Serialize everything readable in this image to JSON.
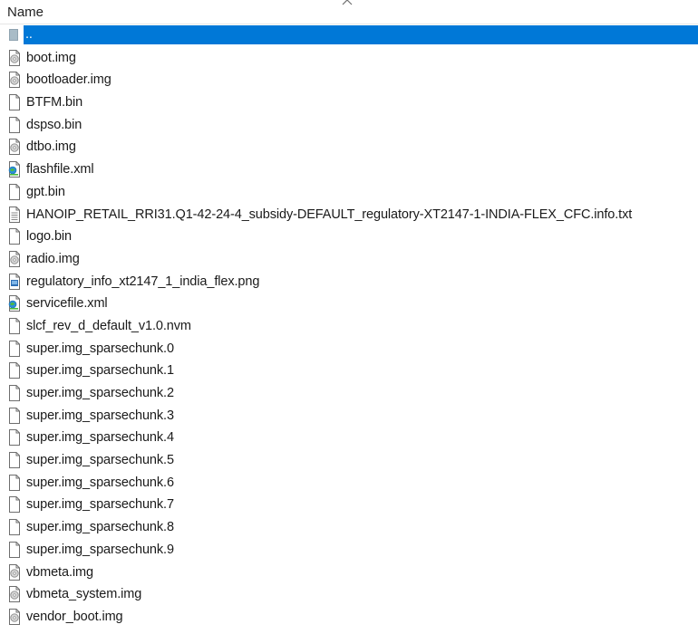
{
  "header": {
    "name_label": "Name"
  },
  "files": [
    {
      "name": "..",
      "icon": "folder-up-icon",
      "type": "parent",
      "selected": true
    },
    {
      "name": "boot.img",
      "icon": "disc-image-icon",
      "type": "img"
    },
    {
      "name": "bootloader.img",
      "icon": "disc-image-icon",
      "type": "img"
    },
    {
      "name": "BTFM.bin",
      "icon": "blank-file-icon",
      "type": "file"
    },
    {
      "name": "dspso.bin",
      "icon": "blank-file-icon",
      "type": "file"
    },
    {
      "name": "dtbo.img",
      "icon": "disc-image-icon",
      "type": "img"
    },
    {
      "name": "flashfile.xml",
      "icon": "xml-file-icon",
      "type": "xml"
    },
    {
      "name": "gpt.bin",
      "icon": "blank-file-icon",
      "type": "file"
    },
    {
      "name": "HANOIP_RETAIL_RRI31.Q1-42-24-4_subsidy-DEFAULT_regulatory-XT2147-1-INDIA-FLEX_CFC.info.txt",
      "icon": "text-file-icon",
      "type": "txt"
    },
    {
      "name": "logo.bin",
      "icon": "blank-file-icon",
      "type": "file"
    },
    {
      "name": "radio.img",
      "icon": "disc-image-icon",
      "type": "img"
    },
    {
      "name": "regulatory_info_xt2147_1_india_flex.png",
      "icon": "image-file-icon",
      "type": "png"
    },
    {
      "name": "servicefile.xml",
      "icon": "xml-file-icon",
      "type": "xml"
    },
    {
      "name": "slcf_rev_d_default_v1.0.nvm",
      "icon": "blank-file-icon",
      "type": "file"
    },
    {
      "name": "super.img_sparsechunk.0",
      "icon": "blank-file-icon",
      "type": "file"
    },
    {
      "name": "super.img_sparsechunk.1",
      "icon": "blank-file-icon",
      "type": "file"
    },
    {
      "name": "super.img_sparsechunk.2",
      "icon": "blank-file-icon",
      "type": "file"
    },
    {
      "name": "super.img_sparsechunk.3",
      "icon": "blank-file-icon",
      "type": "file"
    },
    {
      "name": "super.img_sparsechunk.4",
      "icon": "blank-file-icon",
      "type": "file"
    },
    {
      "name": "super.img_sparsechunk.5",
      "icon": "blank-file-icon",
      "type": "file"
    },
    {
      "name": "super.img_sparsechunk.6",
      "icon": "blank-file-icon",
      "type": "file"
    },
    {
      "name": "super.img_sparsechunk.7",
      "icon": "blank-file-icon",
      "type": "file"
    },
    {
      "name": "super.img_sparsechunk.8",
      "icon": "blank-file-icon",
      "type": "file"
    },
    {
      "name": "super.img_sparsechunk.9",
      "icon": "blank-file-icon",
      "type": "file"
    },
    {
      "name": "vbmeta.img",
      "icon": "disc-image-icon",
      "type": "img"
    },
    {
      "name": "vbmeta_system.img",
      "icon": "disc-image-icon",
      "type": "img"
    },
    {
      "name": "vendor_boot.img",
      "icon": "disc-image-icon",
      "type": "img"
    }
  ],
  "colors": {
    "selection": "#0078d7",
    "header_border": "#e5e5e5"
  }
}
